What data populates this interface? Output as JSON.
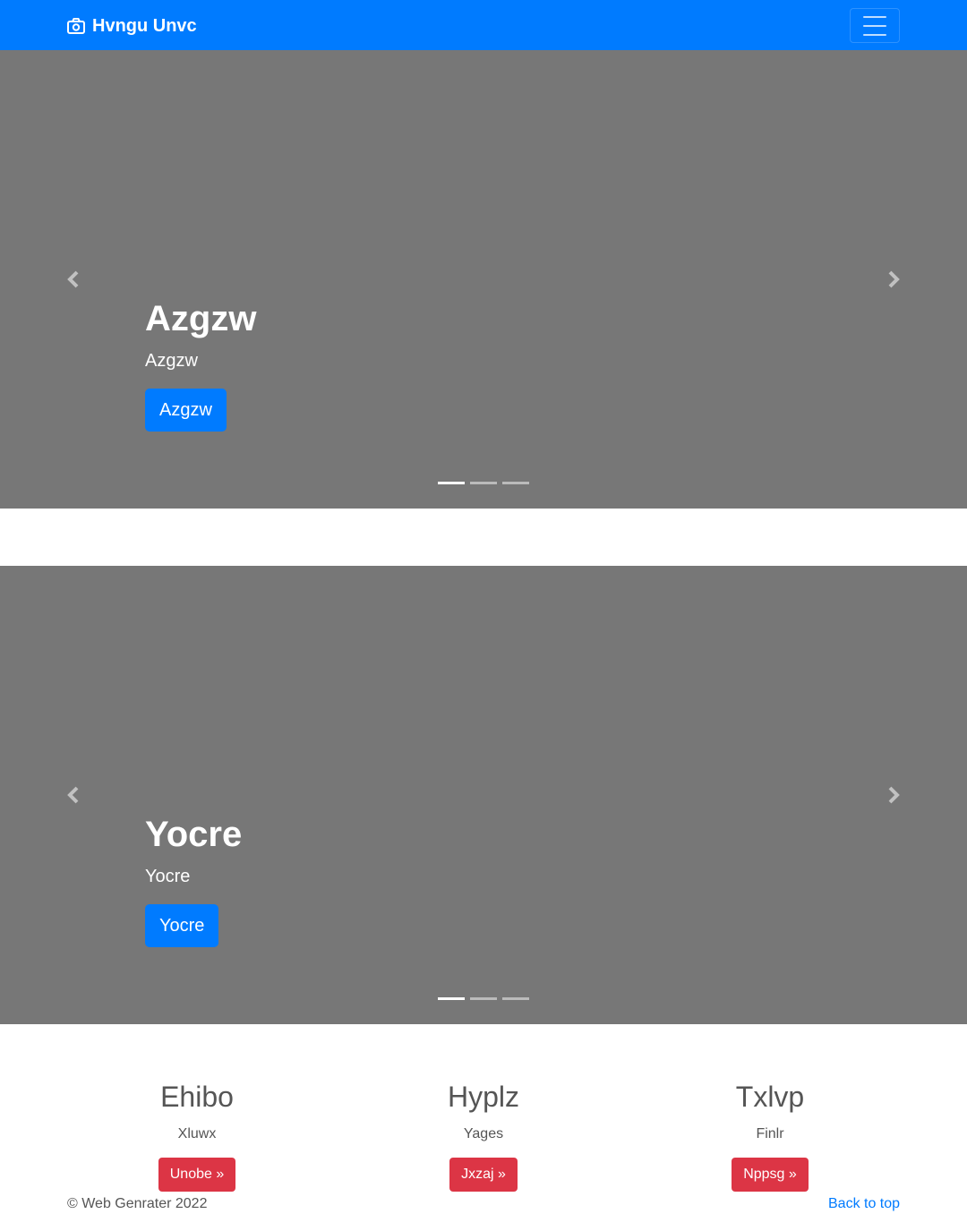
{
  "navbar": {
    "brand": "Hvngu Unvc",
    "brand_icon": "camera-icon",
    "toggler_icon": "hamburger-icon",
    "color": "#007bff"
  },
  "carousels": [
    {
      "title": "Azgzw",
      "text": "Azgzw",
      "button": "Azgzw",
      "slide_count": 3,
      "active_slide": 1
    },
    {
      "title": "Yocre",
      "text": "Yocre",
      "button": "Yocre",
      "slide_count": 3,
      "active_slide": 1
    }
  ],
  "features": [
    {
      "title": "Ehibo",
      "text": "Xluwx",
      "button": "Unobe »"
    },
    {
      "title": "Hyplz",
      "text": "Yages",
      "button": "Jxzaj »"
    },
    {
      "title": "Txlvp",
      "text": "Finlr",
      "button": "Nppsg »"
    }
  ],
  "footer": {
    "copyright": "© Web Genrater 2022",
    "back_to_top": "Back to top"
  },
  "colors": {
    "primary": "#007bff",
    "danger": "#dc3545",
    "slide_bg": "#777777"
  }
}
